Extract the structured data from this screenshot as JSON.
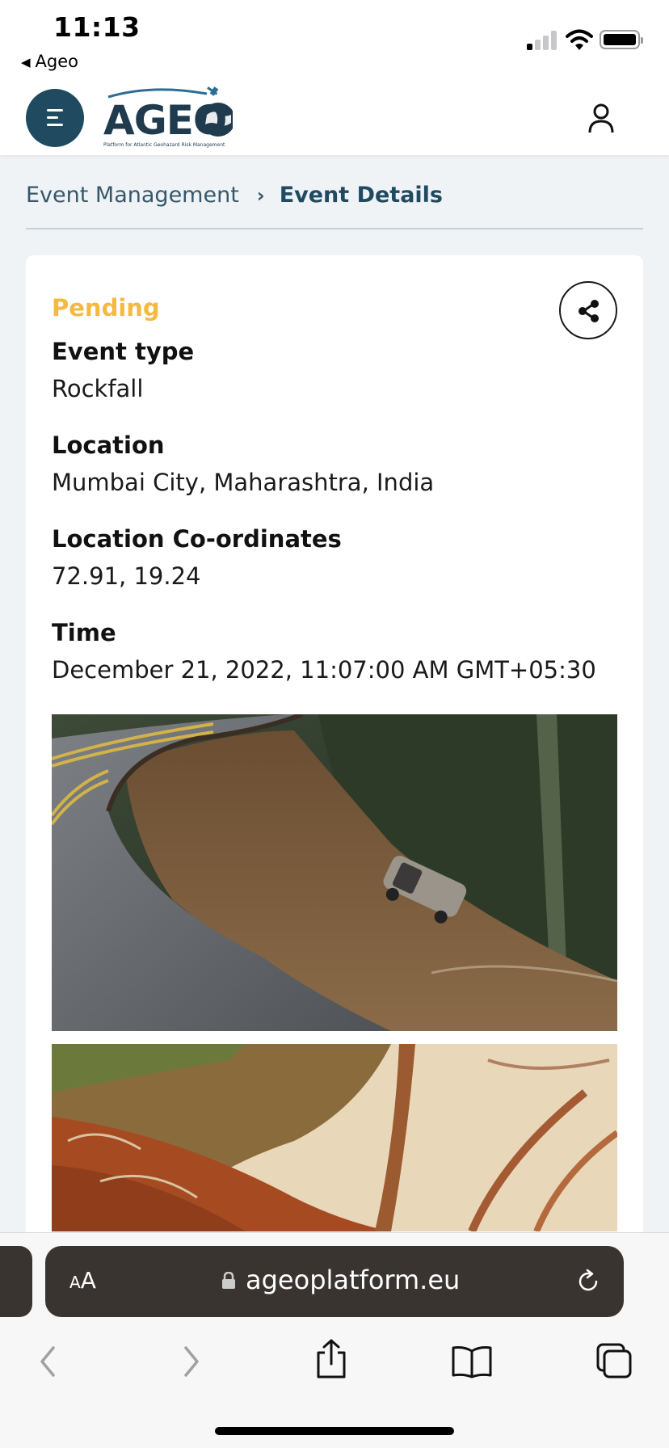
{
  "status_bar": {
    "time": "11:13",
    "back_app": "Ageo"
  },
  "header": {
    "logo_text": "AGEO",
    "logo_tagline": "Platform for Atlantic Geohazard Risk Management"
  },
  "breadcrumb": {
    "parent": "Event Management",
    "current": "Event Details"
  },
  "event": {
    "status": "Pending",
    "fields": [
      {
        "label": "Event type",
        "value": "Rockfall"
      },
      {
        "label": "Location",
        "value": "Mumbai City, Maharashtra, India"
      },
      {
        "label": "Location Co-ordinates",
        "value": "72.91, 19.24"
      },
      {
        "label": "Time",
        "value": "December 21, 2022, 11:07:00 AM GMT+05:30"
      }
    ]
  },
  "browser": {
    "text_size_label": "AA",
    "url": "ageoplatform.eu"
  },
  "colors": {
    "brand_dark": "#1f4a5f",
    "status_pending": "#f4b942",
    "page_bg": "#f0f3f6"
  },
  "icons": [
    "menu-icon",
    "user-icon",
    "share-icon",
    "lock-icon",
    "reload-icon",
    "back-icon",
    "forward-icon",
    "share-sheet-icon",
    "bookmarks-icon",
    "tabs-icon"
  ]
}
